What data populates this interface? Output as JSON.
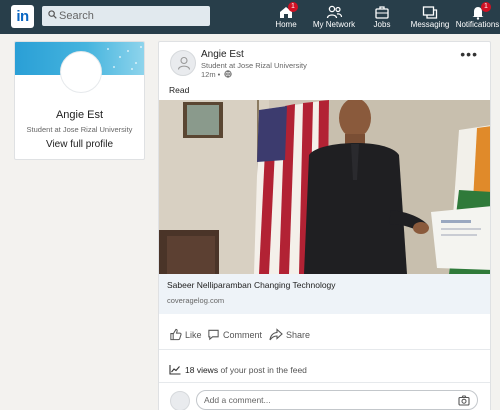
{
  "nav": {
    "logo": "in",
    "search_placeholder": "Search",
    "items": [
      {
        "label": "Home",
        "icon": "home-icon",
        "badge": "1"
      },
      {
        "label": "My Network",
        "icon": "network-icon"
      },
      {
        "label": "Jobs",
        "icon": "jobs-icon"
      },
      {
        "label": "Messaging",
        "icon": "messaging-icon"
      },
      {
        "label": "Notifications",
        "icon": "bell-icon",
        "badge": "1"
      }
    ],
    "bar_color": "#283e4a",
    "badge_color": "#d11124"
  },
  "profile": {
    "name": "Angie Est",
    "headline": "Student at Jose Rizal University",
    "link": "View full profile"
  },
  "post": {
    "author": "Angie Est",
    "headline": "Student at Jose Rizal University",
    "time": "12m •",
    "visibility_icon": "globe-icon",
    "text": "Read",
    "link_title": "Sabeer Nelliparamban Changing Technology",
    "link_source": "coveragelog.com",
    "actions": {
      "like": "Like",
      "comment": "Comment",
      "share": "Share"
    },
    "views": {
      "count": "18 views",
      "rest": " of your post in the feed"
    },
    "comment_placeholder": "Add a comment..."
  }
}
